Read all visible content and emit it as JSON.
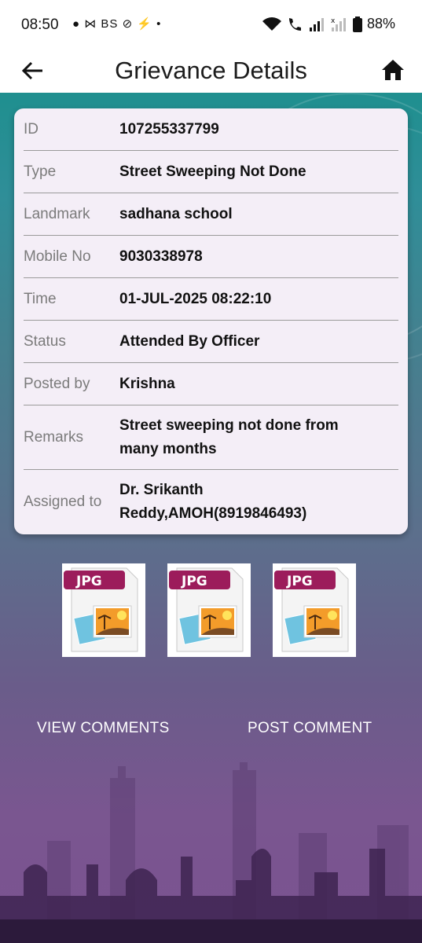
{
  "status_bar": {
    "time": "08:50",
    "notifications": "● ⋈ BS ⊘ ⚡ •",
    "battery": "88%"
  },
  "app_bar": {
    "title": "Grievance Details",
    "back_icon": "arrow-left-icon",
    "home_icon": "home-icon"
  },
  "details": [
    {
      "label": "ID",
      "value": "107255337799"
    },
    {
      "label": "Type",
      "value": "Street Sweeping Not Done"
    },
    {
      "label": "Landmark",
      "value": "sadhana school"
    },
    {
      "label": "Mobile No",
      "value": "9030338978"
    },
    {
      "label": "Time",
      "value": "01-JUL-2025 08:22:10"
    },
    {
      "label": "Status",
      "value": "Attended By Officer"
    },
    {
      "label": "Posted by",
      "value": "Krishna"
    },
    {
      "label": "Remarks",
      "value": "Street sweeping not done from many months"
    },
    {
      "label": "Assigned to",
      "value": "Dr. Srikanth Reddy,AMOH(8919846493)"
    }
  ],
  "attachments": [
    {
      "type": "JPG",
      "icon": "jpg-file-icon"
    },
    {
      "type": "JPG",
      "icon": "jpg-file-icon"
    },
    {
      "type": "JPG",
      "icon": "jpg-file-icon"
    }
  ],
  "actions": {
    "view_comments": "VIEW COMMENTS",
    "post_comment": "POST COMMENT"
  },
  "colors": {
    "card_bg": "#f4eef7",
    "accent_bg_top": "#1f8f8f",
    "accent_bg_bottom": "#7b5291",
    "jpg_badge": "#9c1c5b"
  }
}
